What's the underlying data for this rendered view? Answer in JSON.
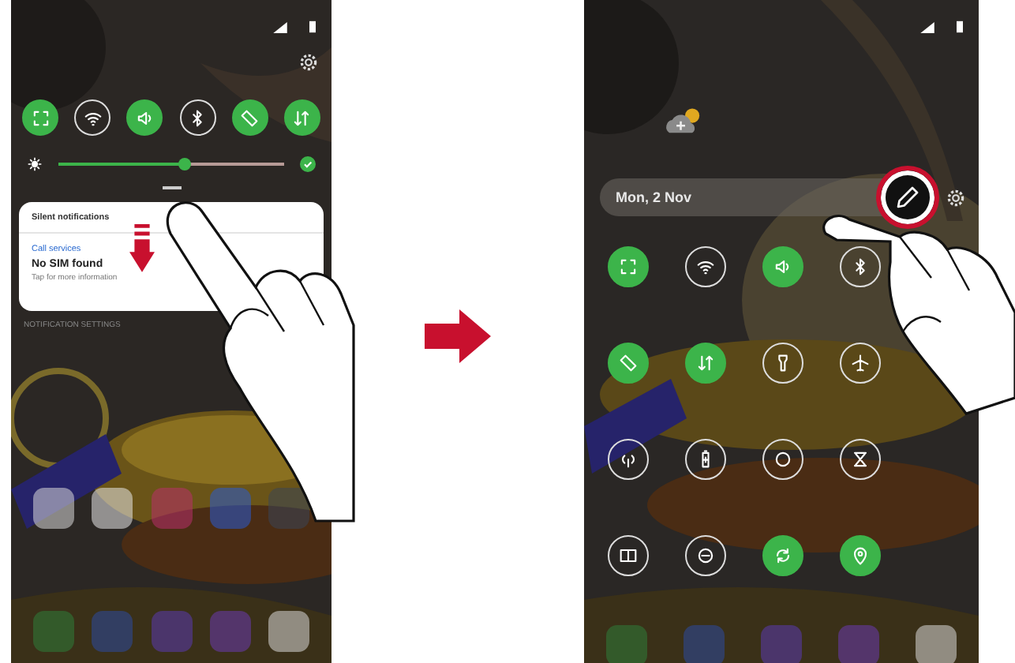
{
  "left_screen": {
    "quick_settings": [
      {
        "on": true
      },
      {
        "on": false
      },
      {
        "on": true
      },
      {
        "on": false
      },
      {
        "on": true
      },
      {
        "on": true
      }
    ],
    "brightness": {
      "level": 0.56,
      "auto": true
    },
    "notification": {
      "header": "Silent notifications",
      "app": "Call services",
      "title": "No SIM found",
      "text": "Tap for more information"
    },
    "settings_link": "NOTIFICATION SETTINGS"
  },
  "right_screen": {
    "date": "Mon, 2 Nov",
    "edit_button": {
      "highlighted": true
    },
    "quick_settings": [
      {
        "on": true
      },
      {
        "on": false
      },
      {
        "on": true
      },
      {
        "on": false
      },
      {
        "on": true
      },
      {
        "on": true
      },
      {
        "on": false
      },
      {
        "on": false
      },
      {
        "on": false
      },
      {
        "on": false
      },
      {
        "on": false
      },
      {
        "on": false
      },
      {
        "on": false
      },
      {
        "on": false
      },
      {
        "on": true
      },
      {
        "on": true
      }
    ]
  }
}
